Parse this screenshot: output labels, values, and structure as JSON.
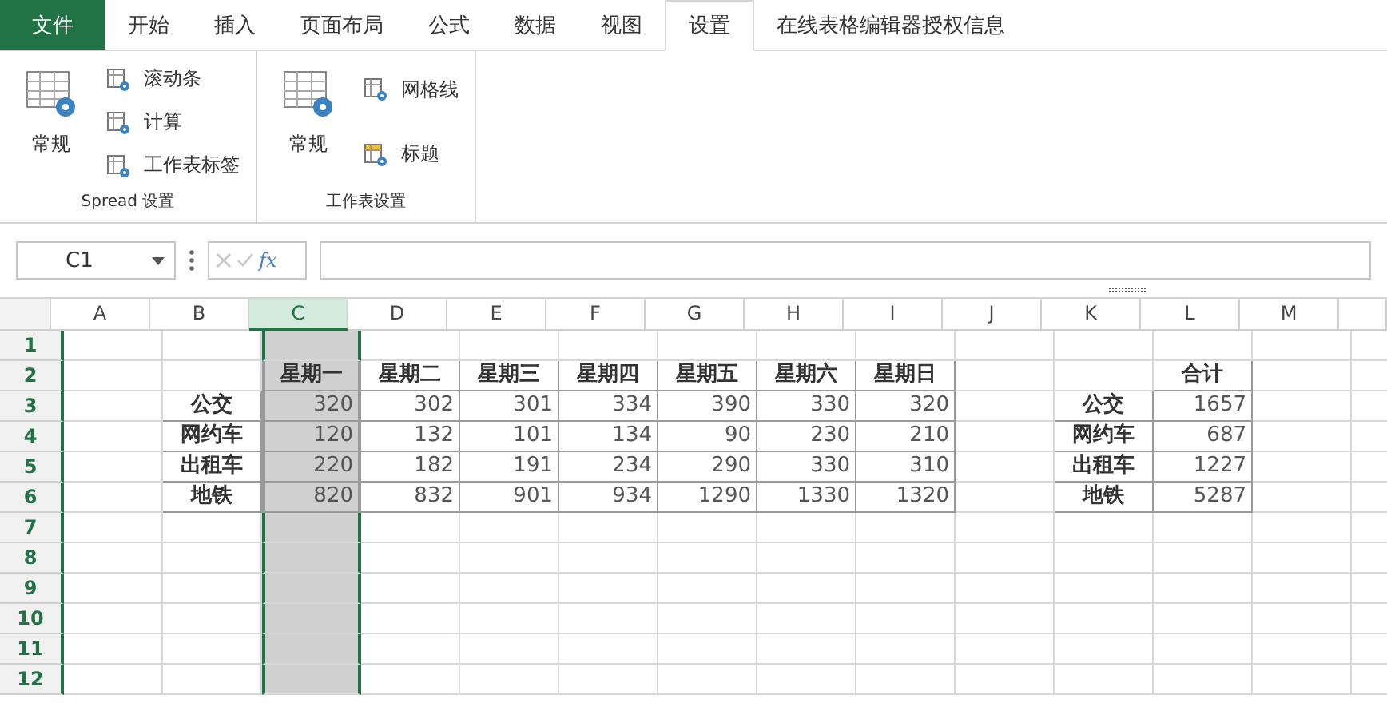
{
  "tabs": [
    {
      "label": "文件",
      "kind": "file",
      "selected": false
    },
    {
      "label": "开始",
      "kind": "tab",
      "selected": false
    },
    {
      "label": "插入",
      "kind": "tab",
      "selected": false
    },
    {
      "label": "页面布局",
      "kind": "tab",
      "selected": false
    },
    {
      "label": "公式",
      "kind": "tab",
      "selected": false
    },
    {
      "label": "数据",
      "kind": "tab",
      "selected": false
    },
    {
      "label": "视图",
      "kind": "tab",
      "selected": false
    },
    {
      "label": "设置",
      "kind": "tab",
      "selected": true
    },
    {
      "label": "在线表格编辑器授权信息",
      "kind": "tab",
      "selected": false
    }
  ],
  "ribbon": {
    "groups": [
      {
        "label": "Spread 设置",
        "items": [
          {
            "label": "常规",
            "kind": "large"
          },
          {
            "label": "滚动条",
            "kind": "small"
          },
          {
            "label": "计算",
            "kind": "small"
          },
          {
            "label": "工作表标签",
            "kind": "small"
          }
        ]
      },
      {
        "label": "工作表设置",
        "items": [
          {
            "label": "常规",
            "kind": "large"
          },
          {
            "label": "网格线",
            "kind": "small"
          },
          {
            "label": "标题",
            "kind": "small"
          }
        ]
      }
    ]
  },
  "formula_bar": {
    "name_box": "C1",
    "function_label": "fx"
  },
  "grid": {
    "columns": [
      {
        "label": "A",
        "selected": false
      },
      {
        "label": "B",
        "selected": false
      },
      {
        "label": "C",
        "selected": true
      },
      {
        "label": "D",
        "selected": false
      },
      {
        "label": "E",
        "selected": false
      },
      {
        "label": "F",
        "selected": false
      },
      {
        "label": "G",
        "selected": false
      },
      {
        "label": "H",
        "selected": false
      },
      {
        "label": "I",
        "selected": false
      },
      {
        "label": "J",
        "selected": false
      },
      {
        "label": "K",
        "selected": false
      },
      {
        "label": "L",
        "selected": false
      },
      {
        "label": "M",
        "selected": false
      }
    ],
    "rows": [
      {
        "label": "1",
        "cells": [
          "",
          "",
          "",
          "",
          "",
          "",
          "",
          "",
          "",
          "",
          "",
          "",
          ""
        ]
      },
      {
        "label": "2",
        "cells": [
          "",
          "",
          {
            "text": "星期一",
            "bold": true
          },
          {
            "text": "星期二",
            "bold": true
          },
          {
            "text": "星期三",
            "bold": true
          },
          {
            "text": "星期四",
            "bold": true
          },
          {
            "text": "星期五",
            "bold": true
          },
          {
            "text": "星期六",
            "bold": true
          },
          {
            "text": "星期日",
            "bold": true
          },
          "",
          "",
          {
            "text": "合计",
            "bold": true
          },
          ""
        ]
      },
      {
        "label": "3",
        "cells": [
          "",
          {
            "text": "公交",
            "bold": true
          },
          {
            "text": "320",
            "bold": false
          },
          {
            "text": "302",
            "bold": false
          },
          {
            "text": "301",
            "bold": false
          },
          {
            "text": "334",
            "bold": false
          },
          {
            "text": "390",
            "bold": false
          },
          {
            "text": "330",
            "bold": false
          },
          {
            "text": "320",
            "bold": false
          },
          "",
          {
            "text": "公交",
            "bold": true
          },
          {
            "text": "1657",
            "bold": false
          },
          ""
        ]
      },
      {
        "label": "4",
        "cells": [
          "",
          {
            "text": "网约车",
            "bold": true
          },
          {
            "text": "120",
            "bold": false
          },
          {
            "text": "132",
            "bold": false
          },
          {
            "text": "101",
            "bold": false
          },
          {
            "text": "134",
            "bold": false
          },
          {
            "text": "90",
            "bold": false
          },
          {
            "text": "230",
            "bold": false
          },
          {
            "text": "210",
            "bold": false
          },
          "",
          {
            "text": "网约车",
            "bold": true
          },
          {
            "text": "687",
            "bold": false
          },
          ""
        ]
      },
      {
        "label": "5",
        "cells": [
          "",
          {
            "text": "出租车",
            "bold": true
          },
          {
            "text": "220",
            "bold": false
          },
          {
            "text": "182",
            "bold": false
          },
          {
            "text": "191",
            "bold": false
          },
          {
            "text": "234",
            "bold": false
          },
          {
            "text": "290",
            "bold": false
          },
          {
            "text": "330",
            "bold": false
          },
          {
            "text": "310",
            "bold": false
          },
          "",
          {
            "text": "出租车",
            "bold": true
          },
          {
            "text": "1227",
            "bold": false
          },
          ""
        ]
      },
      {
        "label": "6",
        "cells": [
          "",
          {
            "text": "地铁",
            "bold": true
          },
          {
            "text": "820",
            "bold": false
          },
          {
            "text": "832",
            "bold": false
          },
          {
            "text": "901",
            "bold": false
          },
          {
            "text": "934",
            "bold": false
          },
          {
            "text": "1290",
            "bold": false
          },
          {
            "text": "1330",
            "bold": false
          },
          {
            "text": "1320",
            "bold": false
          },
          "",
          {
            "text": "地铁",
            "bold": true
          },
          {
            "text": "5287",
            "bold": false
          },
          ""
        ]
      },
      {
        "label": "7",
        "cells": [
          "",
          "",
          "",
          "",
          "",
          "",
          "",
          "",
          "",
          "",
          "",
          "",
          ""
        ]
      },
      {
        "label": "8",
        "cells": [
          "",
          "",
          "",
          "",
          "",
          "",
          "",
          "",
          "",
          "",
          "",
          "",
          ""
        ]
      },
      {
        "label": "9",
        "cells": [
          "",
          "",
          "",
          "",
          "",
          "",
          "",
          "",
          "",
          "",
          "",
          "",
          ""
        ]
      },
      {
        "label": "10",
        "cells": [
          "",
          "",
          "",
          "",
          "",
          "",
          "",
          "",
          "",
          "",
          "",
          "",
          ""
        ]
      },
      {
        "label": "11",
        "cells": [
          "",
          "",
          "",
          "",
          "",
          "",
          "",
          "",
          "",
          "",
          "",
          "",
          ""
        ]
      },
      {
        "label": "12",
        "cells": [
          "",
          "",
          "",
          "",
          "",
          "",
          "",
          "",
          "",
          "",
          "",
          "",
          ""
        ]
      }
    ]
  }
}
